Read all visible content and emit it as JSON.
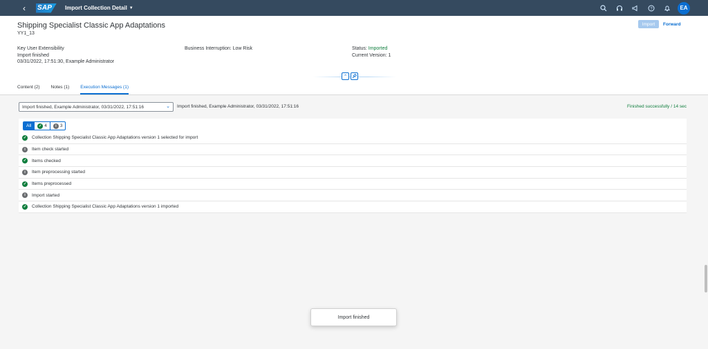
{
  "shell": {
    "logo_text": "SAP",
    "app_title": "Import Collection Detail",
    "avatar_initials": "EA",
    "icons": [
      "search-icon",
      "headset-icon",
      "megaphone-icon",
      "help-icon",
      "bell-icon"
    ]
  },
  "header": {
    "title": "Shipping Specialist Classic App Adaptations",
    "subtitle": "YY1_13",
    "import_label": "Import",
    "forward_label": "Forward",
    "col1": {
      "line1": "Key User Extensibility",
      "line2": "Import finished",
      "line3": "03/31/2022, 17:51:30, Example Administrator"
    },
    "col2": {
      "line1": "Business Interruption: Low Risk"
    },
    "col3": {
      "status_label": "Status:",
      "status_value": "Imported",
      "version_line": "Current Version: 1"
    },
    "tabs": [
      {
        "label": "Content (2)"
      },
      {
        "label": "Notes (1)"
      },
      {
        "label": "Execution Messages (1)"
      }
    ],
    "active_tab": 2
  },
  "messages": {
    "select_value": "Import finished, Example Administrator, 03/31/2022, 17:51:16",
    "selected_text": "Import finished, Example Administrator, 03/31/2022, 17:51:16",
    "finished_text": "Finished successfully / 14 sec",
    "filter": {
      "all_label": "All",
      "success_count": "4",
      "info_count": "3"
    },
    "rows": [
      {
        "type": "success",
        "text": "Collection Shipping Specialist Classic App Adaptations version 1 selected for import"
      },
      {
        "type": "info",
        "text": "Item check started"
      },
      {
        "type": "success",
        "text": "Items checked"
      },
      {
        "type": "info",
        "text": "Item preprocessing started"
      },
      {
        "type": "success",
        "text": "Items preprocessed"
      },
      {
        "type": "info",
        "text": "Import started"
      },
      {
        "type": "success",
        "text": "Collection Shipping Specialist Classic App Adaptations version 1 imported"
      }
    ]
  },
  "toast": {
    "text": "Import finished"
  },
  "colors": {
    "shell_bg": "#354a5f",
    "accent": "#0a6ed1",
    "success": "#107e3e",
    "info": "#6a6d70"
  }
}
